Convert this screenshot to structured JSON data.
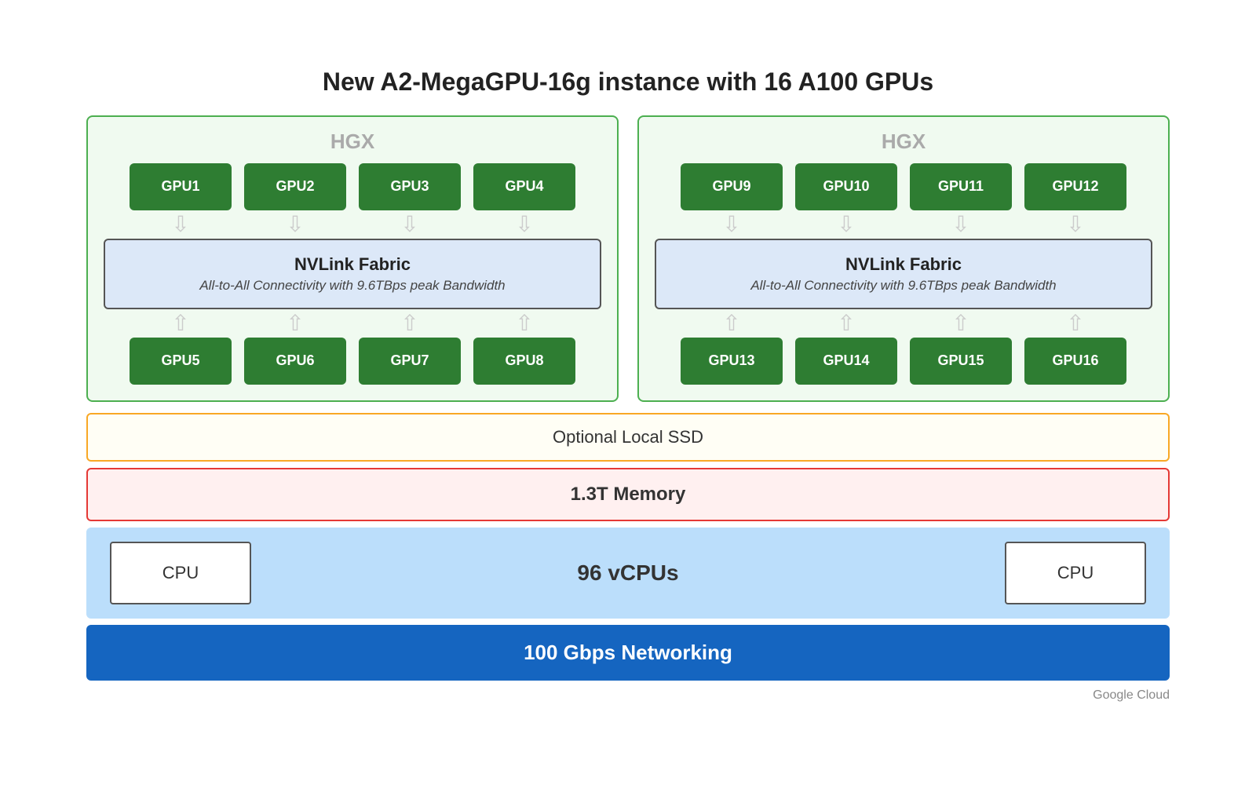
{
  "title": "New A2-MegaGPU-16g instance with 16 A100 GPUs",
  "hgx_left": {
    "label": "HGX",
    "gpus_top": [
      "GPU1",
      "GPU2",
      "GPU3",
      "GPU4"
    ],
    "gpus_bottom": [
      "GPU5",
      "GPU6",
      "GPU7",
      "GPU8"
    ]
  },
  "hgx_right": {
    "label": "HGX",
    "gpus_top": [
      "GPU9",
      "GPU10",
      "GPU11",
      "GPU12"
    ],
    "gpus_bottom": [
      "GPU13",
      "GPU14",
      "GPU15",
      "GPU16"
    ]
  },
  "nvlink": {
    "title": "NVLink Fabric",
    "subtitle": "All-to-All Connectivity with 9.6TBps peak Bandwidth"
  },
  "ssd": {
    "label": "Optional Local SSD"
  },
  "memory": {
    "label": "1.3T Memory"
  },
  "cpu": {
    "left_label": "CPU",
    "vcpu_label": "96 vCPUs",
    "right_label": "CPU"
  },
  "networking": {
    "label": "100 Gbps Networking"
  },
  "footer": {
    "branding": "Google Cloud"
  },
  "arrows": {
    "down": "⬇",
    "up": "⬆"
  }
}
